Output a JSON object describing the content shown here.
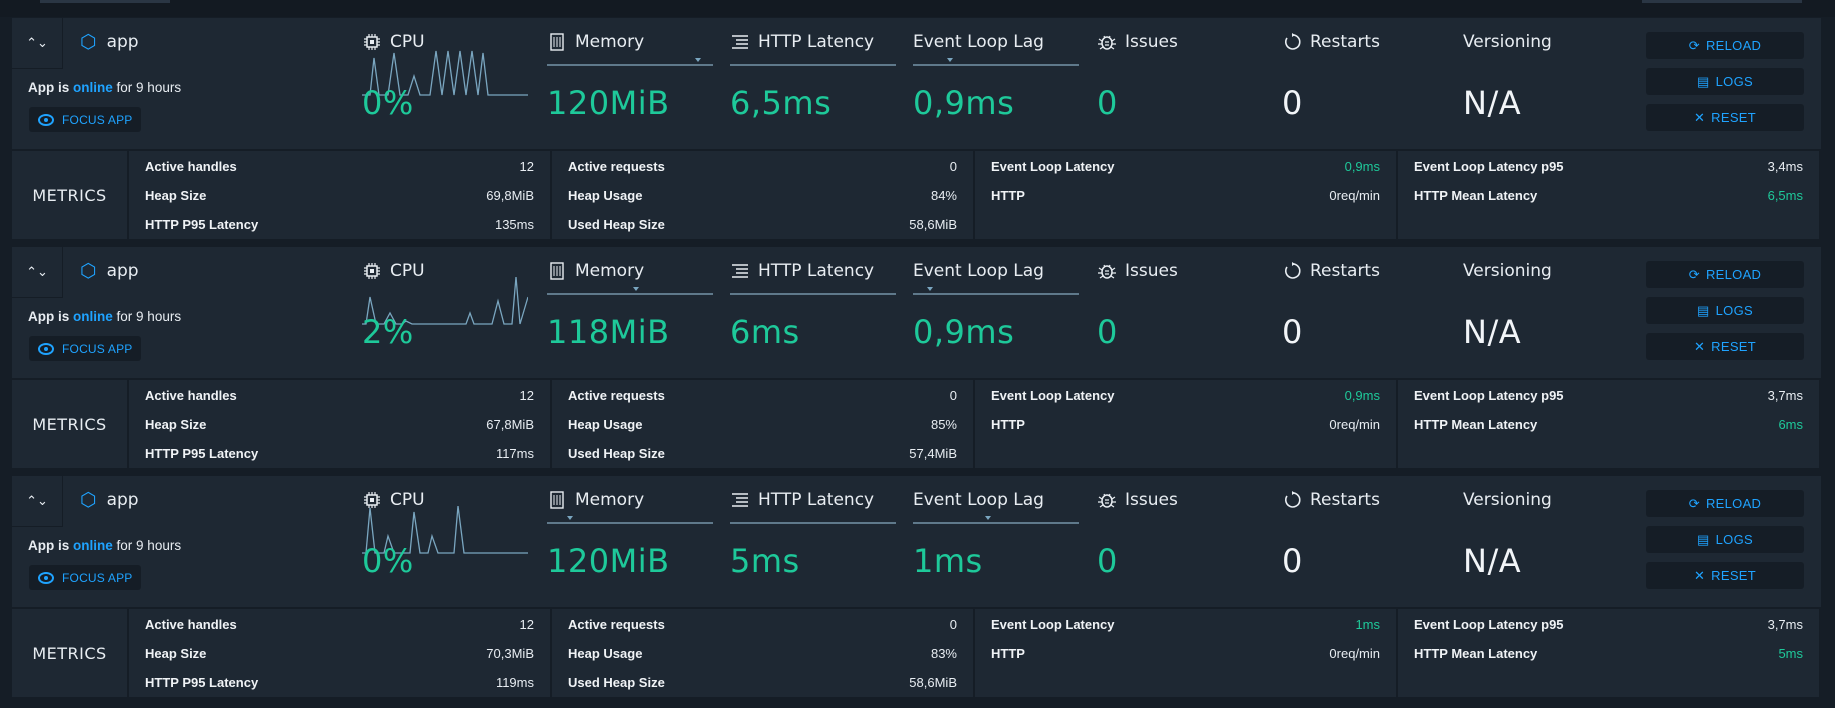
{
  "colors": {
    "accent": "#1fa3ff",
    "value_green": "#1ec99a",
    "panel": "#1e2833",
    "bg": "#151d26"
  },
  "labels": {
    "cpu": "CPU",
    "memory": "Memory",
    "http_latency": "HTTP Latency",
    "event_loop_lag": "Event Loop Lag",
    "issues": "Issues",
    "restarts": "Restarts",
    "versioning": "Versioning",
    "reload": "RELOAD",
    "logs": "LOGS",
    "reset": "RESET",
    "focus": "FOCUS APP",
    "metrics": "METRICS",
    "app_is": "App is",
    "online": "online",
    "for": "for 9 hours"
  },
  "metric_keys": {
    "active_handles": "Active handles",
    "heap_size": "Heap Size",
    "http_p95": "HTTP P95 Latency",
    "active_requests": "Active requests",
    "heap_usage": "Heap Usage",
    "used_heap": "Used Heap Size",
    "el_latency": "Event Loop Latency",
    "http": "HTTP",
    "el_latency_p95": "Event Loop Latency p95",
    "http_mean": "HTTP Mean Latency"
  },
  "processes": [
    {
      "name": "app",
      "cpu": "0%",
      "memory": "120MiB",
      "http_latency": "6,5ms",
      "event_loop_lag": "0,9ms",
      "issues": "0",
      "restarts": "0",
      "versioning": "N/A",
      "metrics": {
        "active_handles": "12",
        "heap_size": "69,8MiB",
        "http_p95": "135ms",
        "active_requests": "0",
        "heap_usage": "84%",
        "used_heap": "58,6MiB",
        "el_latency": "0,9ms",
        "http": "0req/min",
        "el_latency_p95": "3,4ms",
        "http_mean": "6,5ms"
      }
    },
    {
      "name": "app",
      "cpu": "2%",
      "memory": "118MiB",
      "http_latency": "6ms",
      "event_loop_lag": "0,9ms",
      "issues": "0",
      "restarts": "0",
      "versioning": "N/A",
      "metrics": {
        "active_handles": "12",
        "heap_size": "67,8MiB",
        "http_p95": "117ms",
        "active_requests": "0",
        "heap_usage": "85%",
        "used_heap": "57,4MiB",
        "el_latency": "0,9ms",
        "http": "0req/min",
        "el_latency_p95": "3,7ms",
        "http_mean": "6ms"
      }
    },
    {
      "name": "app",
      "cpu": "0%",
      "memory": "120MiB",
      "http_latency": "5ms",
      "event_loop_lag": "1ms",
      "issues": "0",
      "restarts": "0",
      "versioning": "N/A",
      "metrics": {
        "active_handles": "12",
        "heap_size": "70,3MiB",
        "http_p95": "119ms",
        "active_requests": "0",
        "heap_usage": "83%",
        "used_heap": "58,6MiB",
        "el_latency": "1ms",
        "http": "0req/min",
        "el_latency_p95": "3,7ms",
        "http_mean": "5ms"
      }
    }
  ]
}
